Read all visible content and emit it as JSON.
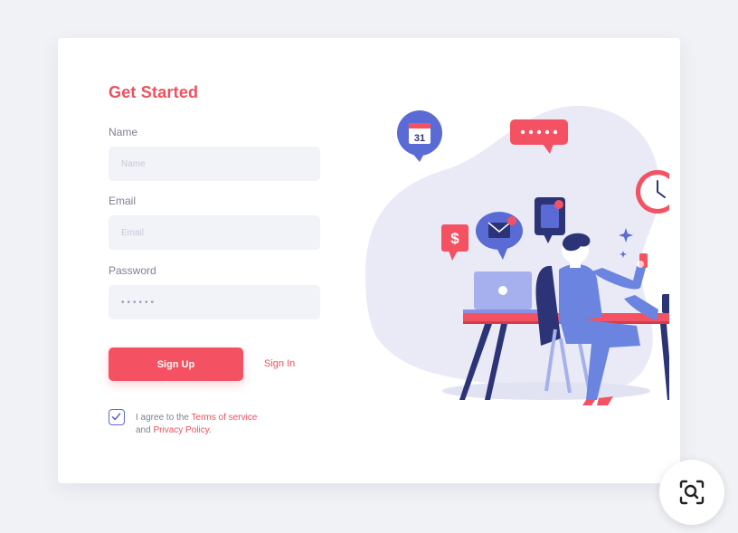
{
  "form": {
    "title": "Get Started",
    "name": {
      "label": "Name",
      "placeholder": "Name",
      "value": ""
    },
    "email": {
      "label": "Email",
      "placeholder": "Email",
      "value": ""
    },
    "password": {
      "label": "Password",
      "value": "••••••"
    },
    "signup_label": "Sign Up",
    "signin_label": "Sign In",
    "agree": {
      "prefix": "I agree to the ",
      "terms_link": "Terms of service",
      "middle": "and ",
      "privacy_link": "Privacy Policy",
      "suffix": ".",
      "checked": true
    }
  },
  "illustration": {
    "calendar_day": "31",
    "money_symbol": "$",
    "icons": [
      "calendar-icon",
      "chat-dots-icon",
      "clock-icon",
      "money-icon",
      "mail-icon",
      "phone-icon",
      "laptop-icon",
      "coffee-cup-icon",
      "person-at-desk"
    ]
  },
  "fab": {
    "icon": "zoom-search-icon"
  },
  "colors": {
    "accent": "#f45262",
    "accent_text": "#f0505e",
    "checkbox": "#5b6bd6",
    "field_bg": "#f1f3f8",
    "page_bg": "#f1f2f6"
  }
}
